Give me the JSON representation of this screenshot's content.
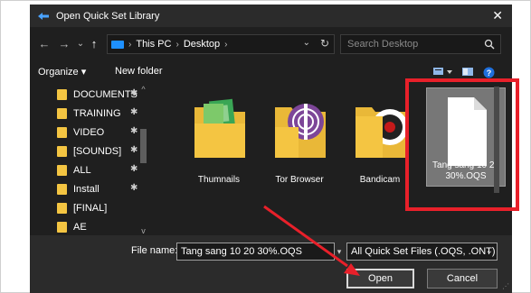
{
  "dialog": {
    "title": "Open Quick Set Library",
    "close_glyph": "✕"
  },
  "nav": {
    "back_glyph": "←",
    "forward_glyph": "→",
    "recent_glyph": "⌄",
    "up_glyph": "↑",
    "breadcrumb": [
      "This PC",
      "Desktop"
    ],
    "separator_glyph": "›",
    "dropdown_glyph": "⌄",
    "refresh_glyph": "↻"
  },
  "search": {
    "placeholder": "Search Desktop"
  },
  "toolbar": {
    "organize_label": "Organize ▾",
    "new_folder_label": "New folder"
  },
  "sidebar": {
    "items": [
      {
        "label": "DOCUMENTS",
        "pinned": true
      },
      {
        "label": "TRAINING",
        "pinned": true
      },
      {
        "label": "VIDEO",
        "pinned": true
      },
      {
        "label": "[SOUNDS]",
        "pinned": true
      },
      {
        "label": "ALL",
        "pinned": true
      },
      {
        "label": "Install",
        "pinned": true
      },
      {
        "label": "[FINAL]",
        "pinned": false
      },
      {
        "label": "AE",
        "pinned": false
      }
    ],
    "pin_glyph": "📌"
  },
  "files": [
    {
      "name": "Thumnails",
      "kind": "folder",
      "icon": "green-folder-icon"
    },
    {
      "name": "Tor Browser",
      "kind": "folder",
      "icon": "tor-browser-folder-icon"
    },
    {
      "name": "Bandicam",
      "kind": "folder",
      "icon": "bandicam-folder-icon"
    },
    {
      "name": "Tang sang 10 20 30%.OQS",
      "kind": "file",
      "icon": "blank-document-icon",
      "selected": true
    }
  ],
  "footer": {
    "file_name_label": "File name:",
    "file_name_value": "Tang sang 10 20 30%.OQS",
    "file_type_value": "All Quick Set Files (.OQS, .ONT)",
    "open_label": "Open",
    "cancel_label": "Cancel"
  },
  "colors": {
    "annotation_red": "#e8202a",
    "dialog_bg": "#1f1f1f",
    "folder_yellow": "#f4c542",
    "accent_blue": "#1e90ff"
  }
}
